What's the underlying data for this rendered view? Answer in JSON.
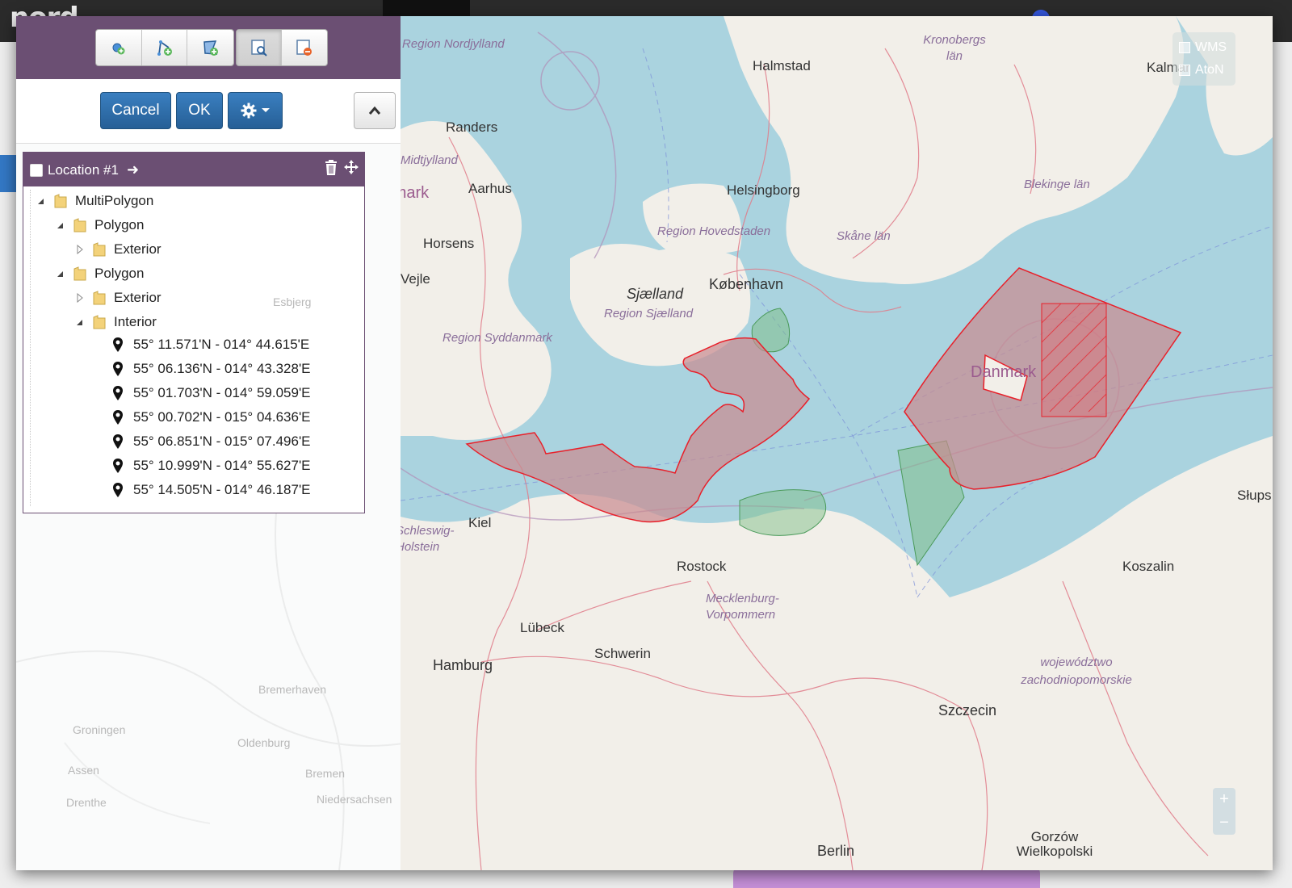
{
  "app": {
    "logo": "nord"
  },
  "toolbar": {
    "draw_tools": [
      "add-point-icon",
      "add-line-icon",
      "add-polygon-icon"
    ],
    "view_tools": [
      "select-area-icon",
      "remove-area-icon"
    ],
    "active_tool": "select-area-icon"
  },
  "actions": {
    "cancel_label": "Cancel",
    "ok_label": "OK"
  },
  "location": {
    "title": "Location #1",
    "tree": {
      "root": "MultiPolygon",
      "polygon1": "Polygon",
      "polygon1_exterior": "Exterior",
      "polygon2": "Polygon",
      "polygon2_exterior": "Exterior",
      "polygon2_interior": "Interior",
      "coordinates": [
        "55° 11.571'N - 014° 44.615'E",
        "55° 06.136'N - 014° 43.328'E",
        "55° 01.703'N - 014° 59.059'E",
        "55° 00.702'N - 015° 04.636'E",
        "55° 06.851'N - 015° 07.496'E",
        "55° 10.999'N - 014° 55.627'E",
        "55° 14.505'N - 014° 46.187'E"
      ]
    }
  },
  "map": {
    "labels": {
      "nordjylland": "Region Nordjylland",
      "halmstad": "Halmstad",
      "kronobergs": "Kronobergs län",
      "kalmar": "Kalmar",
      "randers": "Randers",
      "midtjylland": "Midtjylland",
      "aarhus": "Aarhus",
      "danmark_w": "Danmark",
      "helsingborg": "Helsingborg",
      "blekinge": "Blekinge län",
      "hovedstaden": "Region Hovedstaden",
      "skane": "Skåne län",
      "horsens": "Horsens",
      "vejle": "Vejle",
      "sjaelland": "Sjælland",
      "kobenhavn": "København",
      "region_sjaelland": "Region Sjælland",
      "syddanmark": "Region Syddanmark",
      "danmark_e": "Danmark",
      "slupsk": "Słups",
      "kiel": "Kiel",
      "schleswig": "Schleswig-Holstein",
      "rostock": "Rostock",
      "koszalin": "Koszalin",
      "mecklenburg": "Mecklenburg-Vorpommern",
      "lubeck": "Lübeck",
      "schwerin": "Schwerin",
      "hamburg": "Hamburg",
      "zachodnio": "województwo zachodniopomorskie",
      "szczecin": "Szczecin",
      "gorzow": "Gorzów Wielkopolski",
      "berlin": "Berlin",
      "esbjerg": "Esbjerg",
      "bremerhaven": "Bremerhaven",
      "groningen": "Groningen",
      "oldenburg": "Oldenburg",
      "assen": "Assen",
      "bremen": "Bremen",
      "drenthe": "Drenthe",
      "niedersachsen": "Niedersachsen"
    },
    "layers": [
      "WMS",
      "AtoN"
    ],
    "zoom_in": "+",
    "zoom_out": "−",
    "colors": {
      "sea": "#aad3df",
      "land": "#f2efe9",
      "area_fill": "#c98a8f",
      "area_stroke": "#e8202a",
      "green_zone": "#7fbf8a",
      "panel_purple": "#6b4f73",
      "button_blue": "#2f6ea9"
    }
  }
}
